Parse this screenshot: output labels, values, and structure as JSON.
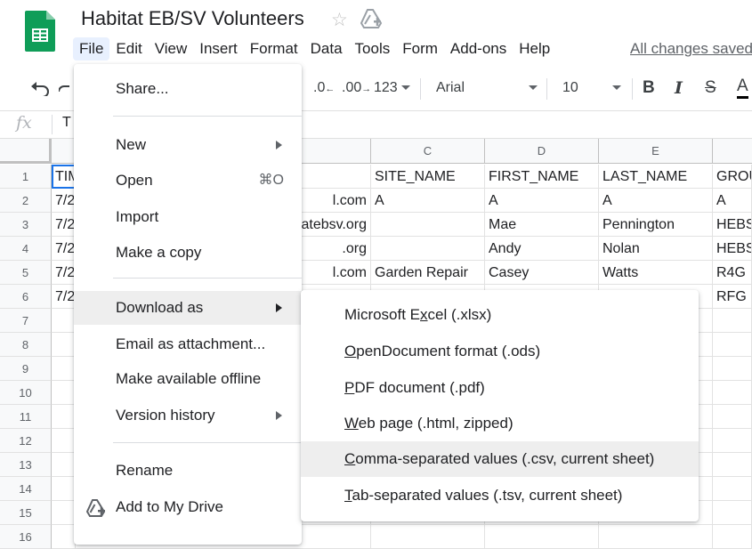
{
  "header": {
    "title": "Habitat EB/SV Volunteers",
    "save_status": "All changes saved",
    "menus": [
      "File",
      "Edit",
      "View",
      "Insert",
      "Format",
      "Data",
      "Tools",
      "Form",
      "Add-ons",
      "Help"
    ]
  },
  "toolbar": {
    "decrease_decimal": ".0",
    "increase_decimal": ".00",
    "number_format": "123",
    "font": "Arial",
    "font_size": "10",
    "bold": "B",
    "italic": "I",
    "strikethrough": "S",
    "text_color": "A"
  },
  "formula_bar": {
    "fx": "fx",
    "value": "T"
  },
  "grid": {
    "columns": [
      "C",
      "D",
      "E"
    ],
    "rows": [
      "1",
      "2",
      "3",
      "4",
      "5",
      "6",
      "7",
      "8",
      "9",
      "10",
      "11",
      "12",
      "13",
      "14",
      "15",
      "16"
    ],
    "col_a": [
      "TIM",
      "7/2",
      "7/2",
      "7/2",
      "7/2",
      "7/2"
    ],
    "col_b": [
      "",
      "l.com",
      "atebsv.org",
      ".org",
      "l.com",
      ""
    ],
    "col_c": [
      "SITE_NAME",
      "A",
      "",
      "",
      "Garden Repair",
      ""
    ],
    "col_d": [
      "FIRST_NAME",
      "A",
      "Mae",
      "Andy",
      "Casey",
      ""
    ],
    "col_e": [
      "LAST_NAME",
      "A",
      "Pennington",
      "Nolan",
      "Watts",
      ""
    ],
    "col_f": [
      "GROU",
      "A",
      "HEBS",
      "HEBS",
      "R4G",
      "RFG"
    ]
  },
  "file_menu": {
    "share": "Share...",
    "new": "New",
    "open": "Open",
    "open_shortcut": "⌘O",
    "import": "Import",
    "make_copy": "Make a copy",
    "download_as": "Download as",
    "email_attachment": "Email as attachment...",
    "offline": "Make available offline",
    "version_history": "Version history",
    "rename": "Rename",
    "add_to_drive": "Add to My Drive"
  },
  "download_menu": {
    "xlsx_pre": "Microsoft E",
    "xlsx_key": "x",
    "xlsx_post": "cel (.xlsx)",
    "ods_key": "O",
    "ods_post": "penDocument format (.ods)",
    "pdf_key": "P",
    "pdf_post": "DF document (.pdf)",
    "html_key": "W",
    "html_post": "eb page (.html, zipped)",
    "csv_key": "C",
    "csv_post": "omma-separated values (.csv, current sheet)",
    "tsv_key": "T",
    "tsv_post": "ab-separated values (.tsv, current sheet)"
  },
  "colors": {
    "accent": "#1a73e8",
    "sheets_green": "#0f9d58",
    "highlight": "#eeeeee"
  }
}
